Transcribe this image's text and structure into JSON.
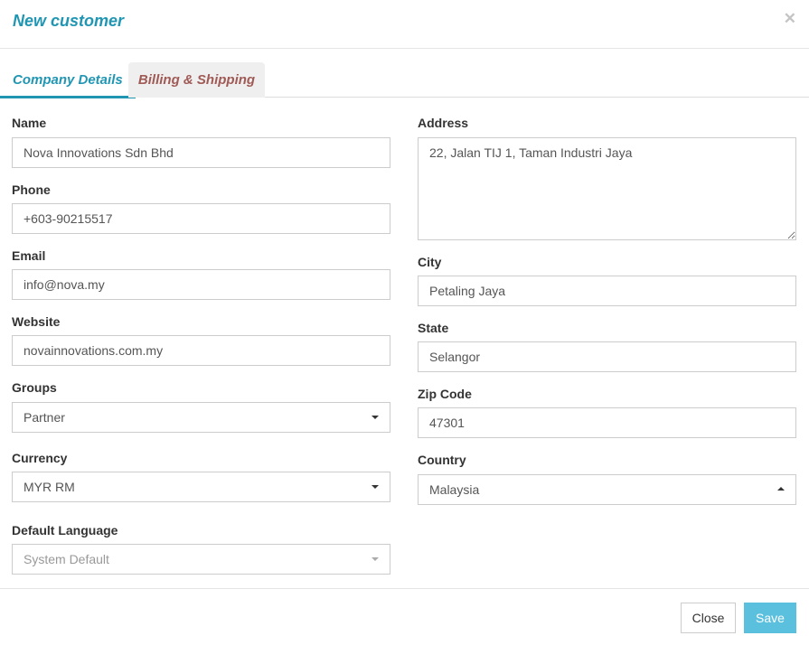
{
  "modal": {
    "title": "New customer",
    "close_icon": "close-icon"
  },
  "tabs": [
    {
      "label": "Company Details",
      "active": true
    },
    {
      "label": "Billing & Shipping",
      "active": false
    }
  ],
  "form": {
    "name": {
      "label": "Name",
      "value": "Nova Innovations Sdn Bhd"
    },
    "phone": {
      "label": "Phone",
      "value": "+603-90215517"
    },
    "email": {
      "label": "Email",
      "value": "info@nova.my"
    },
    "website": {
      "label": "Website",
      "value": "novainnovations.com.my"
    },
    "groups": {
      "label": "Groups",
      "value": "Partner"
    },
    "currency": {
      "label": "Currency",
      "value": "MYR RM"
    },
    "default_language": {
      "label": "Default Language",
      "value": "System Default"
    },
    "address": {
      "label": "Address",
      "value": "22, Jalan TIJ 1, Taman Industri Jaya"
    },
    "city": {
      "label": "City",
      "value": "Petaling Jaya"
    },
    "state": {
      "label": "State",
      "value": "Selangor"
    },
    "zip": {
      "label": "Zip Code",
      "value": "47301"
    },
    "country": {
      "label": "Country",
      "value": "Malaysia"
    }
  },
  "footer": {
    "close_label": "Close",
    "save_label": "Save"
  },
  "colors": {
    "accent": "#2096b3",
    "inactive_tab_text": "#a05a55",
    "save_button": "#5bc0de"
  }
}
